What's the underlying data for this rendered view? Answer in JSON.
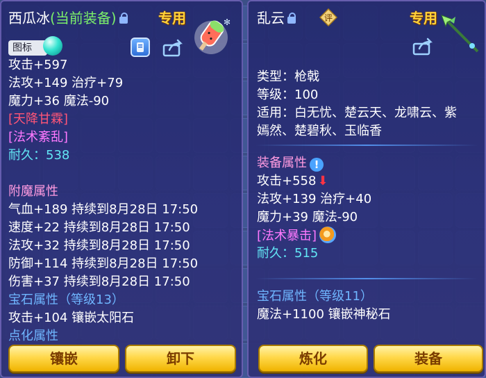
{
  "left": {
    "title_name": "西瓜冰",
    "title_status": "(当前装备)",
    "exclusive": "专用",
    "tag_button": "图标",
    "lines": [
      {
        "text": "攻击+597",
        "cls": ""
      },
      {
        "text": "法攻+149 治疗+79",
        "cls": ""
      },
      {
        "text": "魔力+36 魔法-90",
        "cls": ""
      },
      {
        "text": "[天降甘霖]",
        "cls": "red"
      },
      {
        "text": "[法术紊乱]",
        "cls": "pink"
      },
      {
        "text": "耐久：538",
        "cls": "cyan"
      },
      {
        "text": "",
        "cls": ""
      },
      {
        "text": "附魔属性",
        "cls": "section"
      },
      {
        "text": "气血+189 持续到8月28日 17:50",
        "cls": ""
      },
      {
        "text": "速度+22 持续到8月28日 17:50",
        "cls": ""
      },
      {
        "text": "法攻+32 持续到8月28日 17:50",
        "cls": ""
      },
      {
        "text": "防御+114 持续到8月28日 17:50",
        "cls": ""
      },
      {
        "text": "伤害+37 持续到8月28日 17:50",
        "cls": ""
      },
      {
        "text": "宝石属性（等级13）",
        "cls": "section-blue"
      },
      {
        "text": "攻击+104 镶嵌太阳石",
        "cls": ""
      },
      {
        "text": "点化属性",
        "cls": "section-blue"
      }
    ],
    "buttons": [
      "镶嵌",
      "卸下"
    ]
  },
  "right": {
    "title_name": "乱云",
    "rate_label": "评",
    "exclusive": "专用",
    "info_lines": [
      {
        "text": "类型：枪戟",
        "cls": ""
      },
      {
        "text": "等级：100",
        "cls": ""
      },
      {
        "text": "适用：白无忧、楚云天、龙啸云、紫",
        "cls": ""
      },
      {
        "text": "嫣然、楚碧秋、玉临香",
        "cls": ""
      }
    ],
    "attr_lines": [
      {
        "text": "装备属性",
        "cls": "section"
      },
      {
        "text": "攻击+558",
        "cls": ""
      },
      {
        "text": "法攻+139 治疗+40",
        "cls": ""
      },
      {
        "text": "魔力+39 魔法-90",
        "cls": ""
      },
      {
        "text": "[法术暴击]",
        "cls": "pink"
      },
      {
        "text": "耐久：515",
        "cls": "cyan"
      }
    ],
    "gem_lines": [
      {
        "text": "宝石属性（等级11）",
        "cls": "section-blue"
      },
      {
        "text": "魔法+1100 镶嵌神秘石",
        "cls": ""
      }
    ],
    "buttons": [
      "炼化",
      "装备"
    ]
  },
  "icons": {
    "lock": "lock-icon",
    "share": "share-icon",
    "info": "info-icon",
    "down_arrow": "down-arrow-icon",
    "swirl": "swirl-icon",
    "popsicle": "popsicle-item-icon",
    "spear": "spear-item-icon"
  },
  "colors": {
    "title_status": "#7cf06a",
    "exclusive": "#ffd23a",
    "stat_red": "#ff5577",
    "stat_pink": "#ff79ff",
    "durability": "#62e6f4",
    "section_blue": "#6fb6ff",
    "button_gold": "#ffd84a"
  }
}
